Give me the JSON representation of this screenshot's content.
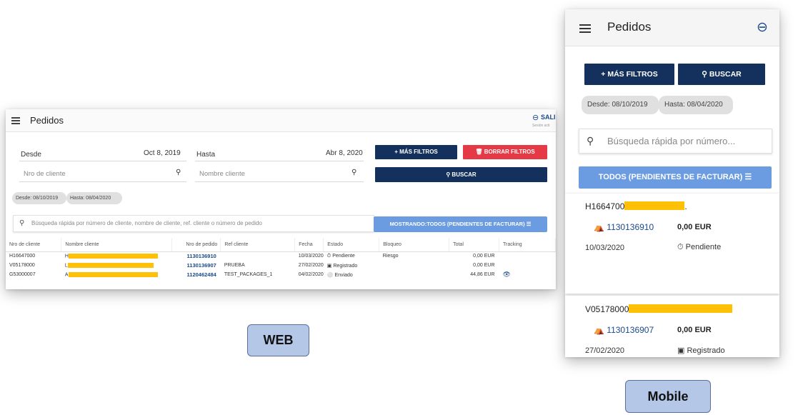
{
  "web": {
    "title": "Pedidos",
    "exit_label": "SALI",
    "session_text": "Sesión acti",
    "desde_label": "Desde",
    "desde_value": "Oct 8, 2019",
    "hasta_label": "Hasta",
    "hasta_value": "Abr 8, 2020",
    "client_number_placeholder": "Nro de cliente",
    "client_name_placeholder": "Nombre cliente",
    "more_filters_button": "+ MÁS FILTROS",
    "clear_filters_button": "BORRAR FILTROS",
    "search_button": "BUSCAR",
    "chip_desde": "Desde: 08/10/2019",
    "chip_hasta": "Hasta: 08/04/2020",
    "quick_search_placeholder": "Búsqueda rápida por número de cliente, nombre de cliente, ref. cliente o número de pedido",
    "showing_button": "MOSTRANDO:TODOS (PENDIENTES DE FACTURAR)",
    "columns": [
      "Nro de cliente",
      "Nombre cliente",
      "Nro de pedido",
      "Ref cliente",
      "Fecha",
      "Estado",
      "Bloqueo",
      "Total",
      "Tracking"
    ],
    "rows": [
      {
        "client": "H16647000",
        "name_visible": "H",
        "order": "1130136910",
        "ref": "",
        "date": "10/03/2020",
        "status": "Pendiente",
        "status_icon": "clock-icon",
        "block": "Riesgo",
        "total": "0,00 EUR",
        "tracking": ""
      },
      {
        "client": "V05178000",
        "name_visible": "L",
        "order": "1130136907",
        "ref": "PRUEBA",
        "date": "27/02/2020",
        "status": "Registrado",
        "status_icon": "briefcase-icon",
        "block": "",
        "total": "0,00 EUR",
        "tracking": ""
      },
      {
        "client": "G53000007",
        "name_visible": "A",
        "order": "1120462484",
        "ref": "TEST_PACKAGES_1",
        "date": "04/02/2020",
        "status": "Enviado",
        "status_icon": "globe-icon",
        "block": "",
        "total": "44,86 EUR",
        "tracking": "eye-icon"
      }
    ]
  },
  "labels": {
    "web": "WEB",
    "mobile": "Mobile"
  },
  "mobile": {
    "title": "Pedidos",
    "more_filters_button": "+ MÁS FILTROS",
    "search_button": "BUSCAR",
    "chip_desde": "Desde: 08/10/2019",
    "chip_hasta": "Hasta: 08/04/2020",
    "quick_search_placeholder": "Búsqueda rápida por número...",
    "showing_button": "TODOS (PENDIENTES DE FACTURAR)",
    "cards": [
      {
        "client": "H1664700",
        "suffix": ".",
        "order": "1130136910",
        "total": "0,00 EUR",
        "date": "10/03/2020",
        "status": "Pendiente"
      },
      {
        "client": "V05178000",
        "suffix": "",
        "order": "1130136907",
        "total": "0,00 EUR",
        "date": "27/02/2020",
        "status": "Registrado"
      }
    ]
  },
  "colors": {
    "navy": "#13315c",
    "red": "#e63946",
    "light_blue": "#6b9be0",
    "redaction": "#ffc107",
    "label_box": "#b4c7e7"
  }
}
